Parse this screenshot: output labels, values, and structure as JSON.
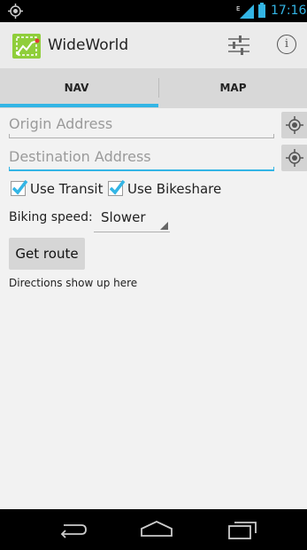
{
  "status_bar": {
    "time": "17:16",
    "icons": [
      "gps-icon",
      "signal-icon",
      "battery-icon"
    ]
  },
  "action_bar": {
    "title": "WideWorld",
    "icon_name": "app-logo-icon",
    "actions": [
      "settings-sliders-icon",
      "info-icon"
    ],
    "info_glyph": "i"
  },
  "tabs": {
    "items": [
      {
        "label": "NAV",
        "selected": true
      },
      {
        "label": "MAP",
        "selected": false
      }
    ]
  },
  "form": {
    "origin": {
      "value": "",
      "placeholder": "Origin Address"
    },
    "destination": {
      "value": "",
      "placeholder": "Destination Address"
    },
    "use_transit": {
      "label": "Use Transit",
      "checked": true
    },
    "use_bikeshare": {
      "label": "Use Bikeshare",
      "checked": true
    },
    "speed": {
      "label": "Biking speed:",
      "value": "Slower"
    },
    "route_button": "Get route",
    "directions": "Directions show up here"
  },
  "nav_bar": {
    "buttons": [
      "back-icon",
      "home-icon",
      "recents-icon"
    ]
  },
  "colors": {
    "accent": "#33b5e5",
    "app_icon": "#8fce3a",
    "action_bar": "#ebebeb",
    "tab_bar": "#d8d8d8"
  }
}
